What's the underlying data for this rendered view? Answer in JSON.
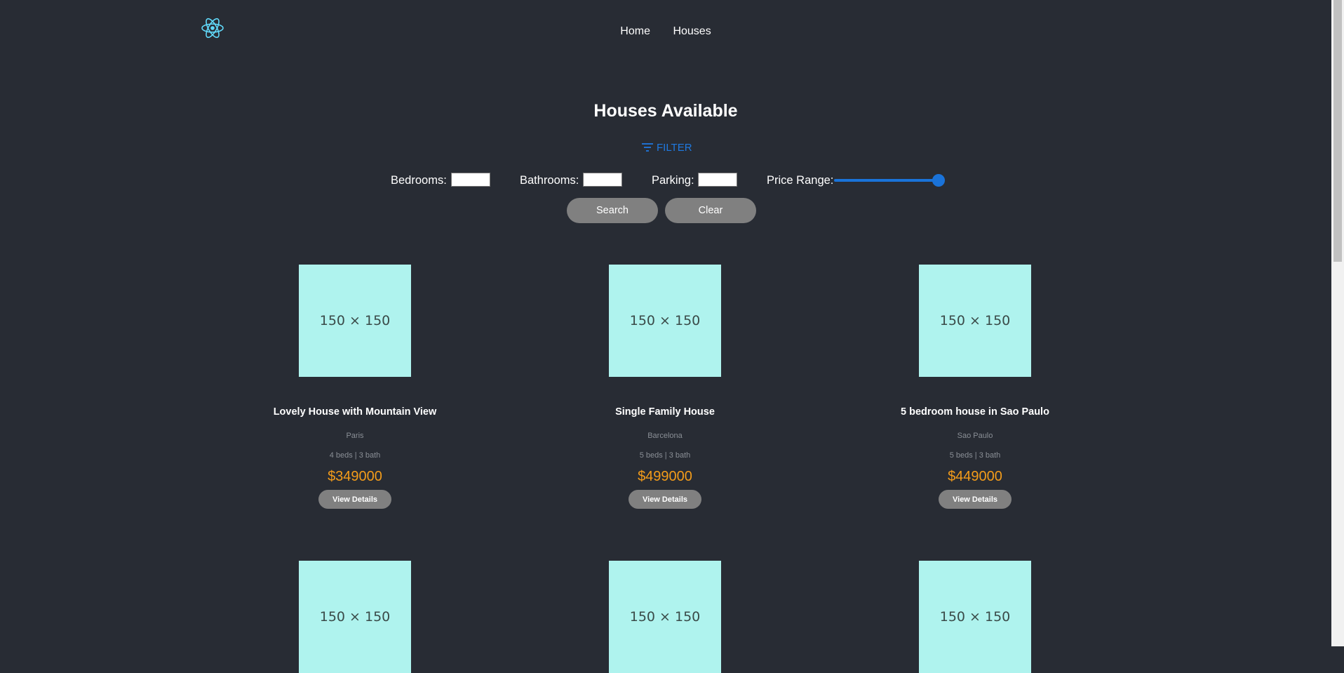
{
  "nav": {
    "links": [
      "Home",
      "Houses"
    ]
  },
  "page": {
    "title": "Houses Available"
  },
  "filter": {
    "toggle_label": "FILTER",
    "bedrooms_label": "Bedrooms:",
    "bathrooms_label": "Bathrooms:",
    "parking_label": "Parking:",
    "price_label": "Price Range:",
    "bedrooms_value": "",
    "bathrooms_value": "",
    "parking_value": "",
    "price_slider_level": 1.0,
    "search_label": "Search",
    "clear_label": "Clear"
  },
  "houses": [
    {
      "image": "150 × 150",
      "title": "Lovely House with Mountain View",
      "city": "Paris",
      "specs": "4 beds | 3 bath",
      "price": "$349000",
      "button": "View Details"
    },
    {
      "image": "150 × 150",
      "title": "Single Family House",
      "city": "Barcelona",
      "specs": "5 beds | 3 bath",
      "price": "$499000",
      "button": "View Details"
    },
    {
      "image": "150 × 150",
      "title": "5 bedroom house in Sao Paulo",
      "city": "Sao Paulo",
      "specs": "5 beds | 3 bath",
      "price": "$449000",
      "button": "View Details"
    },
    {
      "image": "150 × 150"
    },
    {
      "image": "150 × 150"
    },
    {
      "image": "150 × 150"
    }
  ],
  "colors": {
    "background": "#282c34",
    "accent": "#1a73d9",
    "price": "#f39c1a",
    "thumbnail": "#aff3ee"
  },
  "icons": {
    "logo": "react-logo-icon",
    "filter": "filter-icon"
  }
}
